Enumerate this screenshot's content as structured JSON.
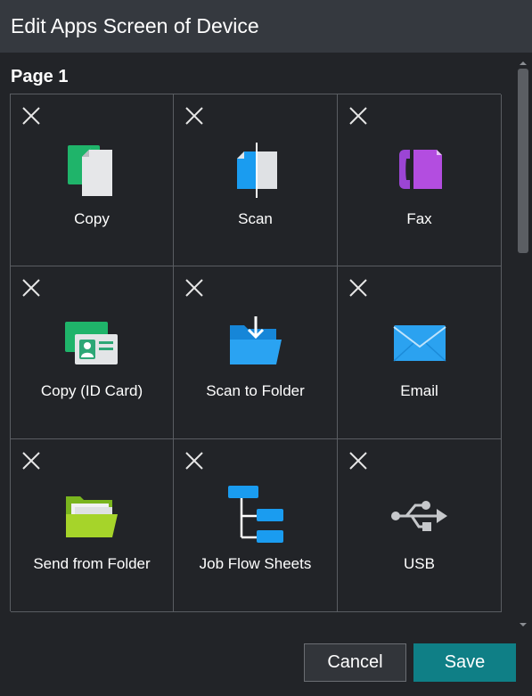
{
  "window": {
    "title": "Edit Apps Screen of Device"
  },
  "page": {
    "label": "Page 1"
  },
  "tiles": [
    {
      "label": "Copy",
      "icon": "copy-icon"
    },
    {
      "label": "Scan",
      "icon": "scan-icon"
    },
    {
      "label": "Fax",
      "icon": "fax-icon"
    },
    {
      "label": "Copy (ID Card)",
      "icon": "id-card-copy-icon"
    },
    {
      "label": "Scan to Folder",
      "icon": "scan-to-folder-icon"
    },
    {
      "label": "Email",
      "icon": "email-icon"
    },
    {
      "label": "Send from Folder",
      "icon": "send-from-folder-icon"
    },
    {
      "label": "Job Flow Sheets",
      "icon": "job-flow-sheets-icon"
    },
    {
      "label": "USB",
      "icon": "usb-icon"
    }
  ],
  "footer": {
    "cancel_label": "Cancel",
    "save_label": "Save"
  },
  "colors": {
    "accent": "#0f7f86",
    "background": "#222428",
    "titlebar": "#35393f"
  }
}
